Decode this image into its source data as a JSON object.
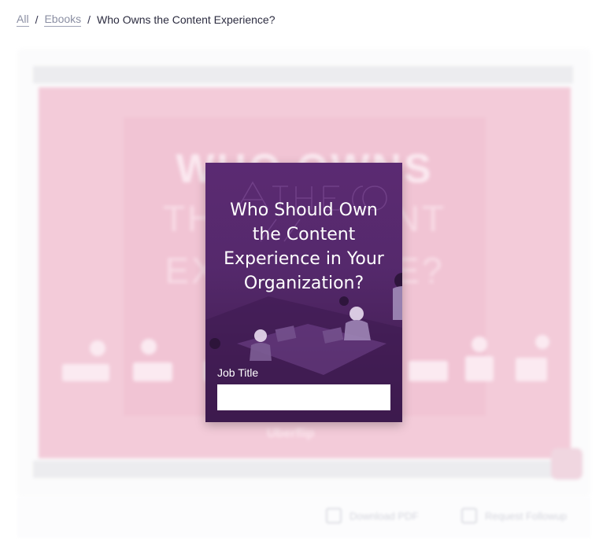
{
  "breadcrumb": {
    "items": [
      {
        "label": "All"
      },
      {
        "label": "Ebooks"
      }
    ],
    "separator": "/",
    "current": "Who Owns the Content Experience?"
  },
  "document_preview": {
    "cover_lines": [
      "WHO OWNS",
      "THE CONTENT",
      "EXPERIENCE?"
    ],
    "brand": "Uberflip"
  },
  "actions": {
    "download_label": "Download PDF",
    "request_label": "Request Followup"
  },
  "gate": {
    "title": "Who Should Own the Content Experience in Your Organization?",
    "field_label": "Job Title",
    "field_value": "",
    "field_placeholder": ""
  },
  "colors": {
    "gate_purple": "#5b2a72",
    "cover_pink": "#f3cbd9",
    "link_gray": "#8b8fa3"
  }
}
